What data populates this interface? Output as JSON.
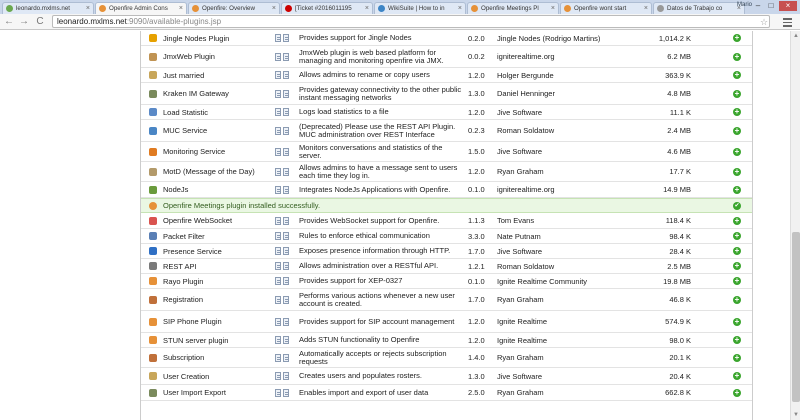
{
  "browser": {
    "tabs": [
      {
        "title": "leonardo.mxlms.net",
        "favicon_color": "#6aa84f"
      },
      {
        "title": "Openfire Admin Cons",
        "favicon_color": "#e69138"
      },
      {
        "title": "Openfire: Overview",
        "favicon_color": "#e69138"
      },
      {
        "title": "[Ticket #2016011195",
        "favicon_color": "#cc0000"
      },
      {
        "title": "WikiSuite | How to in",
        "favicon_color": "#3d85c6"
      },
      {
        "title": "Openfire Meetings Pl",
        "favicon_color": "#e69138"
      },
      {
        "title": "Openfire wont start",
        "favicon_color": "#e69138"
      },
      {
        "title": "Datos de Trabajo co",
        "favicon_color": "#999999"
      }
    ],
    "tab_close": "×",
    "user_label": "Mario",
    "window_buttons": [
      "–",
      "□",
      "×"
    ],
    "nav": {
      "back": "←",
      "forward": "→",
      "reload": "C"
    },
    "url_host": "leonardo.mxlms.net",
    "url_path": ":9090/available-plugins.jsp",
    "star": "☆"
  },
  "plugins": [
    {
      "name": "Jingle Nodes Plugin",
      "icon": "jingle-icon",
      "icon_color": "#e6a100",
      "description": "Provides support for Jingle Nodes",
      "version": "0.2.0",
      "author": "Jingle Nodes (Rodrigo Martins)",
      "size": "1,014.2 K"
    },
    {
      "name": "JmxWeb Plugin",
      "icon": "jmx-icon",
      "icon_color": "#c09353",
      "description": "JmxWeb plugin is web based platform for managing and monitoring openfire via JMX.",
      "version": "0.0.2",
      "author": "igniterealtime.org",
      "size": "6.2 MB"
    },
    {
      "name": "Just married",
      "icon": "rings-icon",
      "icon_color": "#c8a65a",
      "description": "Allows admins to rename or copy users",
      "version": "1.2.0",
      "author": "Holger Bergunde",
      "size": "363.9 K"
    },
    {
      "name": "Kraken IM Gateway",
      "icon": "gateway-icon",
      "icon_color": "#7a8a5c",
      "description": "Provides gateway connectivity to the other public instant messaging networks",
      "version": "1.3.0",
      "author": "Daniel Henninger",
      "size": "4.8 MB"
    },
    {
      "name": "Load Statistic",
      "icon": "statistics-icon",
      "icon_color": "#5b8ac7",
      "description": "Logs load statistics to a file",
      "version": "1.2.0",
      "author": "Jive Software",
      "size": "11.1 K"
    },
    {
      "name": "MUC Service",
      "icon": "muc-icon",
      "icon_color": "#4a86c5",
      "description": "(Deprecated) Please use the REST API Plugin. MUC administration over REST Interface",
      "version": "0.2.3",
      "author": "Roman Soldatow",
      "size": "2.4 MB"
    },
    {
      "name": "Monitoring Service",
      "icon": "monitoring-icon",
      "icon_color": "#e07b21",
      "description": "Monitors conversations and statistics of the server.",
      "version": "1.5.0",
      "author": "Jive Software",
      "size": "4.6 MB"
    },
    {
      "name": "MotD (Message of the Day)",
      "icon": "motd-icon",
      "icon_color": "#b39a6a",
      "description": "Allows admins to have a message sent to users each time they log in.",
      "version": "1.2.0",
      "author": "Ryan Graham",
      "size": "17.7 K"
    },
    {
      "name": "NodeJs",
      "icon": "nodejs-icon",
      "icon_color": "#6a9b3c",
      "description": "Integrates NodeJs Applications with Openfire.",
      "version": "0.1.0",
      "author": "igniterealtime.org",
      "size": "14.9 MB"
    },
    {
      "success": true,
      "message": "Openfire Meetings plugin installed successfully.",
      "icon": "openfire-icon",
      "icon_color": "#e69138"
    },
    {
      "name": "Openfire WebSocket",
      "icon": "websocket-icon",
      "icon_color": "#d9534f",
      "description": "Provides WebSocket support for Openfire.",
      "version": "1.1.3",
      "author": "Tom Evans",
      "size": "118.4 K"
    },
    {
      "name": "Packet Filter",
      "icon": "filter-icon",
      "icon_color": "#5a7fb5",
      "description": "Rules to enforce ethical communication",
      "version": "3.3.0",
      "author": "Nate Putnam",
      "size": "98.4 K"
    },
    {
      "name": "Presence Service",
      "icon": "presence-icon",
      "icon_color": "#2f6fc4",
      "description": "Exposes presence information through HTTP.",
      "version": "1.7.0",
      "author": "Jive Software",
      "size": "28.4 K"
    },
    {
      "name": "REST API",
      "icon": "rest-icon",
      "icon_color": "#7a7a7a",
      "description": "Allows administration over a RESTful API.",
      "version": "1.2.1",
      "author": "Roman Soldatow",
      "size": "2.5 MB"
    },
    {
      "name": "Rayo Plugin",
      "icon": "rayo-icon",
      "icon_color": "#e69138",
      "description": "Provides support for XEP-0327",
      "version": "0.1.0",
      "author": "Ignite Realtime Community",
      "size": "19.8 MB"
    },
    {
      "name": "Registration",
      "icon": "registration-icon",
      "icon_color": "#c0703a",
      "description": "Performs various actions whenever a new user account is created.",
      "version": "1.7.0",
      "author": "Ryan Graham",
      "size": "46.8 K"
    },
    {
      "name": "SIP Phone Plugin",
      "icon": "sip-phone-icon",
      "icon_color": "#e69138",
      "description": "Provides support for SIP account management",
      "version": "1.2.0",
      "author": "Ignite Realtime",
      "size": "574.9 K"
    },
    {
      "name": "STUN server plugin",
      "icon": "stun-icon",
      "icon_color": "#e69138",
      "description": "Adds STUN functionality to Openfire",
      "version": "1.2.0",
      "author": "Ignite Realtime",
      "size": "98.0 K"
    },
    {
      "name": "Subscription",
      "icon": "subscription-icon",
      "icon_color": "#c0703a",
      "description": "Automatically accepts or rejects subscription requests",
      "version": "1.4.0",
      "author": "Ryan Graham",
      "size": "20.1 K"
    },
    {
      "name": "User Creation",
      "icon": "user-creation-icon",
      "icon_color": "#c8a65a",
      "description": "Creates users and populates rosters.",
      "version": "1.3.0",
      "author": "Jive Software",
      "size": "20.4 K"
    },
    {
      "name": "User Import Export",
      "icon": "import-export-icon",
      "icon_color": "#7a8a5c",
      "description": "Enables import and export of user data",
      "version": "2.5.0",
      "author": "Ryan Graham",
      "size": "662.8 K"
    }
  ]
}
